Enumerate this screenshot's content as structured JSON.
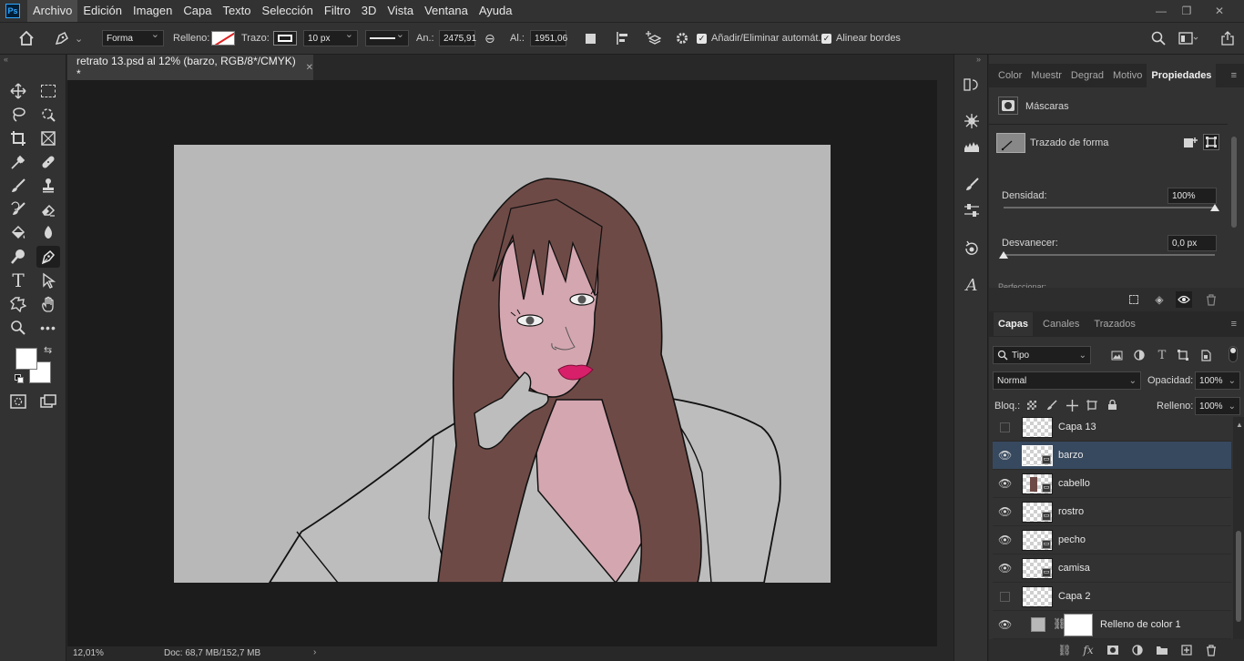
{
  "app": {
    "logo": "Ps"
  },
  "menu": [
    "Archivo",
    "Edición",
    "Imagen",
    "Capa",
    "Texto",
    "Selección",
    "Filtro",
    "3D",
    "Vista",
    "Ventana",
    "Ayuda"
  ],
  "window_controls": {
    "minimize": "—",
    "restore": "❐",
    "close": "✕"
  },
  "options": {
    "mode": "Forma",
    "fill_label": "Relleno:",
    "stroke_label": "Trazo:",
    "stroke_width": "10 px",
    "width_label": "An.:",
    "width_value": "2475,91",
    "link_icon": "⊖",
    "height_label": "Al.:",
    "height_value": "1951,06",
    "auto_add_label": "Añadir/Eliminar automát.",
    "align_edges_label": "Alinear bordes"
  },
  "document": {
    "tab_title": "retrato 13.psd al 12% (barzo, RGB/8*/CMYK) *",
    "zoom": "12,01%",
    "doc_info": "Doc: 68,7 MB/152,7 MB",
    "canvas_bg": "#b8b8b8"
  },
  "properties_panel": {
    "tabs": [
      "Color",
      "Muestr",
      "Degrad",
      "Motivo",
      "Propiedades"
    ],
    "active_tab": "Propiedades",
    "masks_label": "Máscaras",
    "path_label": "Trazado de forma",
    "density_label": "Densidad:",
    "density_value": "100%",
    "density_fraction": 1.0,
    "feather_label": "Desvanecer:",
    "feather_value": "0,0 px",
    "feather_fraction": 0.0,
    "refine_label": "Perfeccionar:"
  },
  "layers_panel": {
    "tabs": [
      "Capas",
      "Canales",
      "Trazados"
    ],
    "active_tab": "Capas",
    "filter_kind": "Tipo",
    "blend_mode": "Normal",
    "opacity_label": "Opacidad:",
    "opacity_value": "100%",
    "lock_label": "Bloq.:",
    "fill_label": "Relleno:",
    "fill_value": "100%",
    "layers": [
      {
        "name": "Capa 13",
        "visible": false,
        "selected": false,
        "mask": false
      },
      {
        "name": "barzo",
        "visible": true,
        "selected": true,
        "mask": true
      },
      {
        "name": "cabello",
        "visible": true,
        "selected": false,
        "mask": true
      },
      {
        "name": "rostro",
        "visible": true,
        "selected": false,
        "mask": true
      },
      {
        "name": "pecho",
        "visible": true,
        "selected": false,
        "mask": true
      },
      {
        "name": "camisa",
        "visible": true,
        "selected": false,
        "mask": true
      },
      {
        "name": "Capa 2",
        "visible": false,
        "selected": false,
        "mask": false
      },
      {
        "name": "Relleno de color 1",
        "visible": true,
        "selected": false,
        "mask": false
      }
    ],
    "footer_fx": "fx"
  },
  "colors": {
    "accent": "#31a8ff",
    "hair": "#6e4a46",
    "skin": "#d4a6b0",
    "lips": "#d81f6a"
  }
}
